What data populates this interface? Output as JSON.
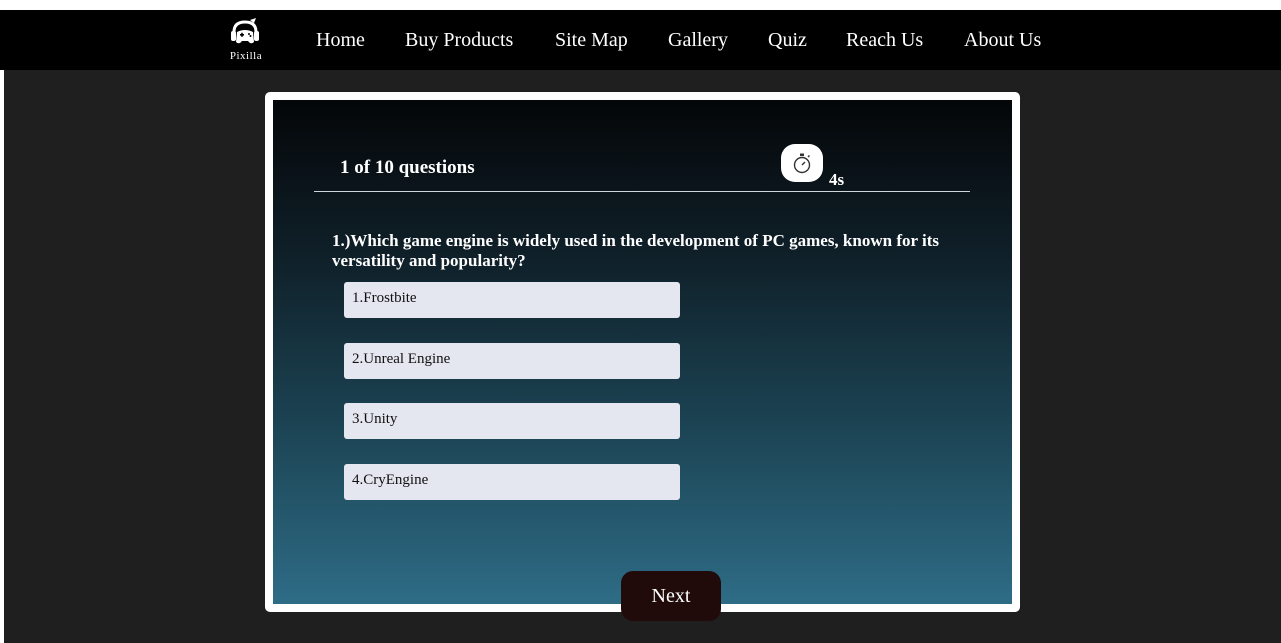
{
  "nav": {
    "logo_text": "Pixilla",
    "items": [
      "Home",
      "Buy Products",
      "Site Map",
      "Gallery",
      "Quiz",
      "Reach Us",
      "About Us"
    ]
  },
  "quiz": {
    "progress": "1 of 10 questions",
    "timer": "4s",
    "question": "1.)Which game engine is widely used in the development of PC games, known for its versatility and popularity?",
    "options": [
      "1.Frostbite",
      "2.Unreal Engine",
      "3.Unity",
      "4.CryEngine"
    ],
    "next_label": "Next"
  },
  "icons": {
    "logo": "gamepad-headphones-icon",
    "timer": "stopwatch-icon"
  },
  "colors": {
    "navbar": "#000000",
    "page_bg": "#1f1f1f",
    "card_gradient_top": "#040608",
    "card_gradient_bottom": "#2e6c86",
    "option_bg": "#e4e6f0",
    "next_button": "#200a0a"
  }
}
